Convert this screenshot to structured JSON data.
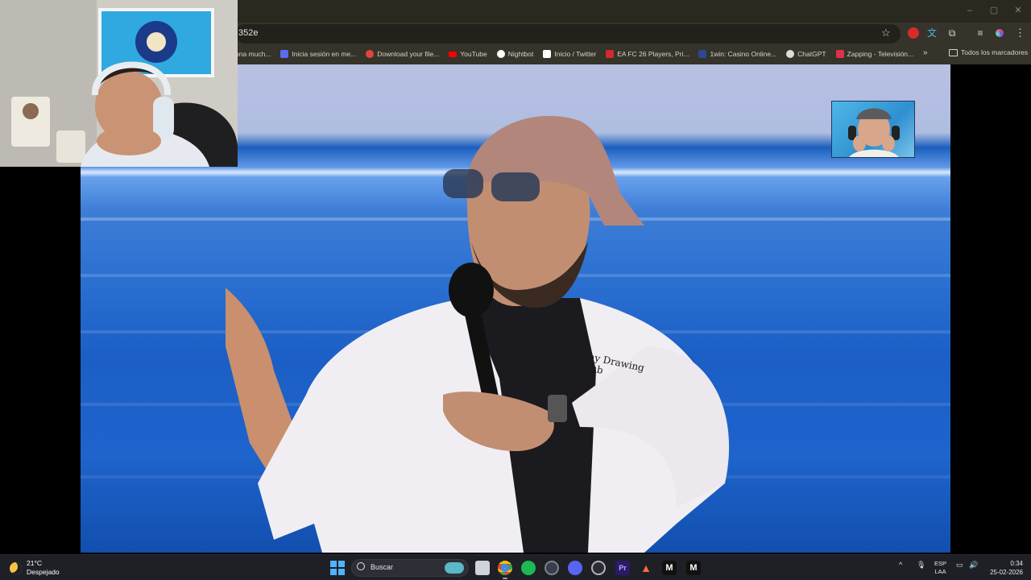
{
  "browser": {
    "url": "352e",
    "window_controls": [
      "–",
      "▢",
      "✕"
    ],
    "bookmarks": [
      {
        "label": "ona much...",
        "icon_color": "#35332a"
      },
      {
        "label": "Inicia sesión en me...",
        "icon_color": "#5a6cf0"
      },
      {
        "label": "Download your file...",
        "icon_color": "#e2463a"
      },
      {
        "label": "YouTube",
        "icon_color": "#ff0000"
      },
      {
        "label": "Nightbot",
        "icon_color": "#ffffff"
      },
      {
        "label": "Inicio / Twitter",
        "icon_color": "#ffffff"
      },
      {
        "label": "EA FC 26 Players, Pri...",
        "icon_color": "#d12b2b"
      },
      {
        "label": "1win: Casino Online...",
        "icon_color": "#2c4a8a"
      },
      {
        "label": "ChatGPT",
        "icon_color": "#dcdcdc"
      },
      {
        "label": "Zapping - Televisión...",
        "icon_color": "#e0304a"
      }
    ],
    "bookmarks_more": "»",
    "all_bookmarks": "Todos los marcadores"
  },
  "taskbar": {
    "temperature": "21°C",
    "weather": "Despejado",
    "search_placeholder": "Buscar",
    "language": "ESP",
    "layout": "LAA",
    "time": "0:34",
    "date": "25-02-2026",
    "tray_chevron": "^",
    "icons": [
      "windows-start-icon",
      "search-icon",
      "file-explorer-icon",
      "chrome-icon",
      "spotify-icon",
      "obs-icon",
      "discord-icon",
      "steam-icon",
      "premiere-icon",
      "adobe-icon",
      "capcut-icon",
      "davinci-icon"
    ]
  },
  "colors": {
    "chrome_bg": "#35332a",
    "taskbar_bg": "#1f2026",
    "video_sea": "#2a6fd0"
  }
}
